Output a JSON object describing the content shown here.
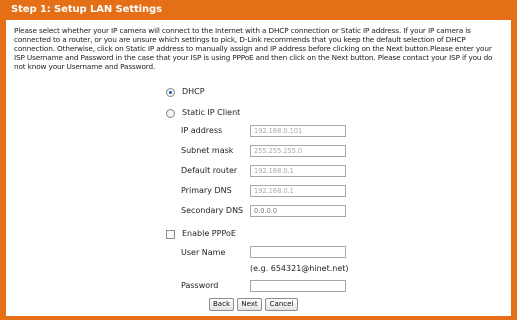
{
  "header": {
    "title": "Step 1: Setup LAN Settings"
  },
  "intro": {
    "text": "Please select whether your IP camera will connect to the Internet with a DHCP connection or Static IP address. If your IP camera is connected to a router, or you are unsure which settings to pick, D-Link recommends that you keep the default selection of DHCP connection. Otherwise, click on Static IP address to manually assign and IP address before clicking on the Next button.Please enter your ISP Username and Password in the case that your ISP is using PPPoE and then click on the Next button. Please contact your ISP if you do not know your Username and Password."
  },
  "connection": {
    "dhcp_label": "DHCP",
    "dhcp_selected": true,
    "static_label": "Static IP Client",
    "static_selected": false
  },
  "static_fields": {
    "ip_label": "IP address",
    "ip_value": "192.168.0.101",
    "mask_label": "Subnet mask",
    "mask_value": "255.255.255.0",
    "router_label": "Default router",
    "router_value": "192.168.0.1",
    "dns1_label": "Primary DNS",
    "dns1_value": "192.168.0.1",
    "dns2_label": "Secondary DNS",
    "dns2_value": "0.0.0.0"
  },
  "pppoe": {
    "enable_label": "Enable PPPoE",
    "enabled": false,
    "username_label": "User Name",
    "username_value": "",
    "hint": "(e.g. 654321@hinet.net)",
    "password_label": "Password",
    "password_value": ""
  },
  "buttons": {
    "back": "Back",
    "next": "Next",
    "cancel": "Cancel"
  },
  "colors": {
    "accent": "#e46f16",
    "radio_dot": "#1f5faa"
  }
}
